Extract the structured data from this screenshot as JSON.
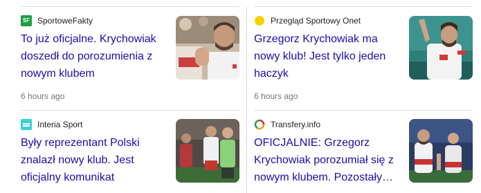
{
  "cards": [
    {
      "source": "SportoweFakty",
      "favicon_text": "SF",
      "favicon_icon": "sportowefakty-logo-icon",
      "headline": "To już oficjalne. Krychowiak doszedł do porozumienia z nowym klubem",
      "time": "6 hours ago",
      "thumb_icon": "player-applauding-photo"
    },
    {
      "source": "Przegląd Sportowy Onet",
      "favicon_icon": "onet-logo-icon",
      "headline": "Grzegorz Krychowiak ma nowy klub! Jest tylko jeden haczyk",
      "time": "6 hours ago",
      "thumb_icon": "player-waving-photo"
    },
    {
      "source": "Interia Sport",
      "favicon_icon": "interia-logo-icon",
      "headline": "Były reprezentant Polski znalazł nowy klub. Jest oficjalny komunikat",
      "thumb_icon": "players-on-pitch-photo"
    },
    {
      "source": "Transfery.info",
      "favicon_icon": "transfery-logo-icon",
      "headline": "OFICJALNIE: Grzegorz Krychowiak porozumiał się z nowym klubem. Pozostały…",
      "thumb_icon": "players-celebrating-photo"
    }
  ],
  "colors": {
    "headline": "#1a0dab",
    "source": "#202124",
    "time": "#70757a",
    "divider": "#dadce0"
  }
}
